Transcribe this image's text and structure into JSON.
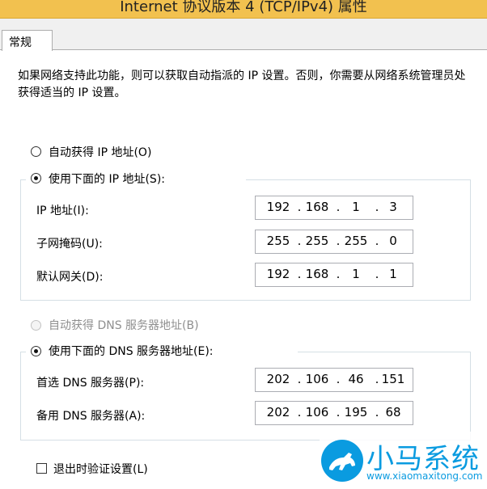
{
  "window": {
    "title": "Internet 协议版本 4 (TCP/IPv4) 属性"
  },
  "tabs": [
    {
      "label": "常规"
    }
  ],
  "description": "如果网络支持此功能，则可以获取自动指派的 IP 设置。否则，你需要从网络系统管理员处获得适当的 IP 设置。",
  "ip_section": {
    "auto_option": "自动获得 IP 地址(O)",
    "manual_option": "使用下面的 IP 地址(S):",
    "selected": "manual",
    "fields": [
      {
        "label": "IP 地址(I):",
        "value": [
          "192",
          "168",
          "1",
          "3"
        ]
      },
      {
        "label": "子网掩码(U):",
        "value": [
          "255",
          "255",
          "255",
          "0"
        ]
      },
      {
        "label": "默认网关(D):",
        "value": [
          "192",
          "168",
          "1",
          "1"
        ]
      }
    ]
  },
  "dns_section": {
    "auto_option": "自动获得 DNS 服务器地址(B)",
    "auto_disabled": true,
    "manual_option": "使用下面的 DNS 服务器地址(E):",
    "selected": "manual",
    "fields": [
      {
        "label": "首选 DNS 服务器(P):",
        "value": [
          "202",
          "106",
          "46",
          "151"
        ]
      },
      {
        "label": "备用 DNS 服务器(A):",
        "value": [
          "202",
          "106",
          "195",
          "68"
        ]
      }
    ]
  },
  "validate_on_exit": {
    "label": "退出时验证设置(L)",
    "checked": false
  },
  "watermark": {
    "title": "小马系统",
    "url": "www.xiaomaxitong.com",
    "icon": "horse-logo-icon"
  },
  "colors": {
    "accent_titlebar": "#f2c14f",
    "watermark": "#0a9be0"
  }
}
